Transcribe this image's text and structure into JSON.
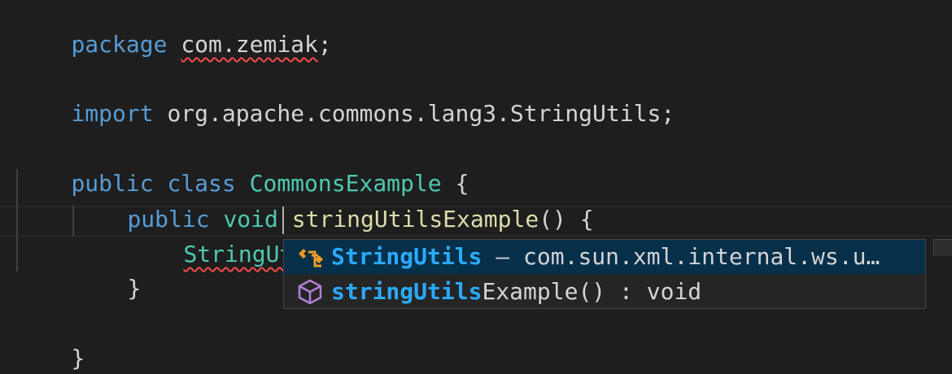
{
  "code": {
    "line1": {
      "keyword": "package",
      "name": "com.zemiak",
      "semi": ";"
    },
    "line3": {
      "keyword": "import",
      "path": "org.apache.commons.lang3.StringUtils;"
    },
    "line5": {
      "kw1": "public",
      "kw2": "class",
      "classname": "CommonsExample",
      "brace": "{"
    },
    "line6": {
      "kw1": "public",
      "kw2": "void",
      "method": "stringUtilsExample",
      "rest": "() {"
    },
    "line7": {
      "typed": "StringUtils"
    },
    "line8": {
      "brace": "}"
    },
    "line10": {
      "brace": "}"
    }
  },
  "suggest": {
    "items": [
      {
        "icon": "class-icon",
        "highlight": "StringUtils",
        "rest": " – com.sun.xml.internal.ws.u…",
        "selected": true
      },
      {
        "icon": "method-icon",
        "highlight": "stringUtils",
        "rest": "Example() : void",
        "selected": false
      }
    ]
  },
  "colors": {
    "background": "#1e1e1e",
    "keyword": "#569cd6",
    "type": "#4ec9b0",
    "function": "#dcdcaa",
    "text": "#d4d4d4",
    "error": "#f14c4c",
    "match": "#2aaaff",
    "selection": "#062f4a"
  }
}
